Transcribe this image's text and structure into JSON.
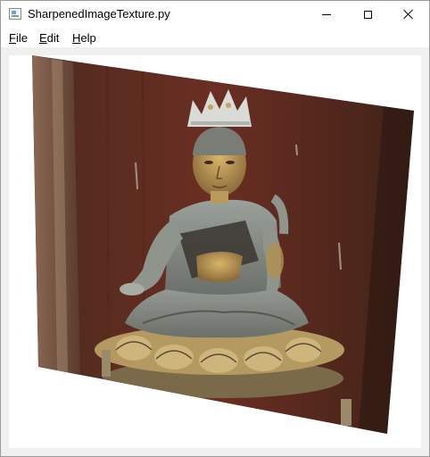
{
  "window": {
    "title": "SharpenedImageTexture.py",
    "app_icon": "python-window-icon",
    "controls": {
      "minimize_icon": "minimize-icon",
      "maximize_icon": "maximize-icon",
      "close_icon": "close-icon"
    }
  },
  "menu": {
    "file": {
      "mnemonic": "F",
      "rest": "ile"
    },
    "edit": {
      "mnemonic": "E",
      "rest": "dit"
    },
    "help": {
      "mnemonic": "H",
      "rest": "elp"
    }
  },
  "viewport": {
    "background": "#ffffff",
    "texture_subject": "seated buddha statue photo"
  }
}
